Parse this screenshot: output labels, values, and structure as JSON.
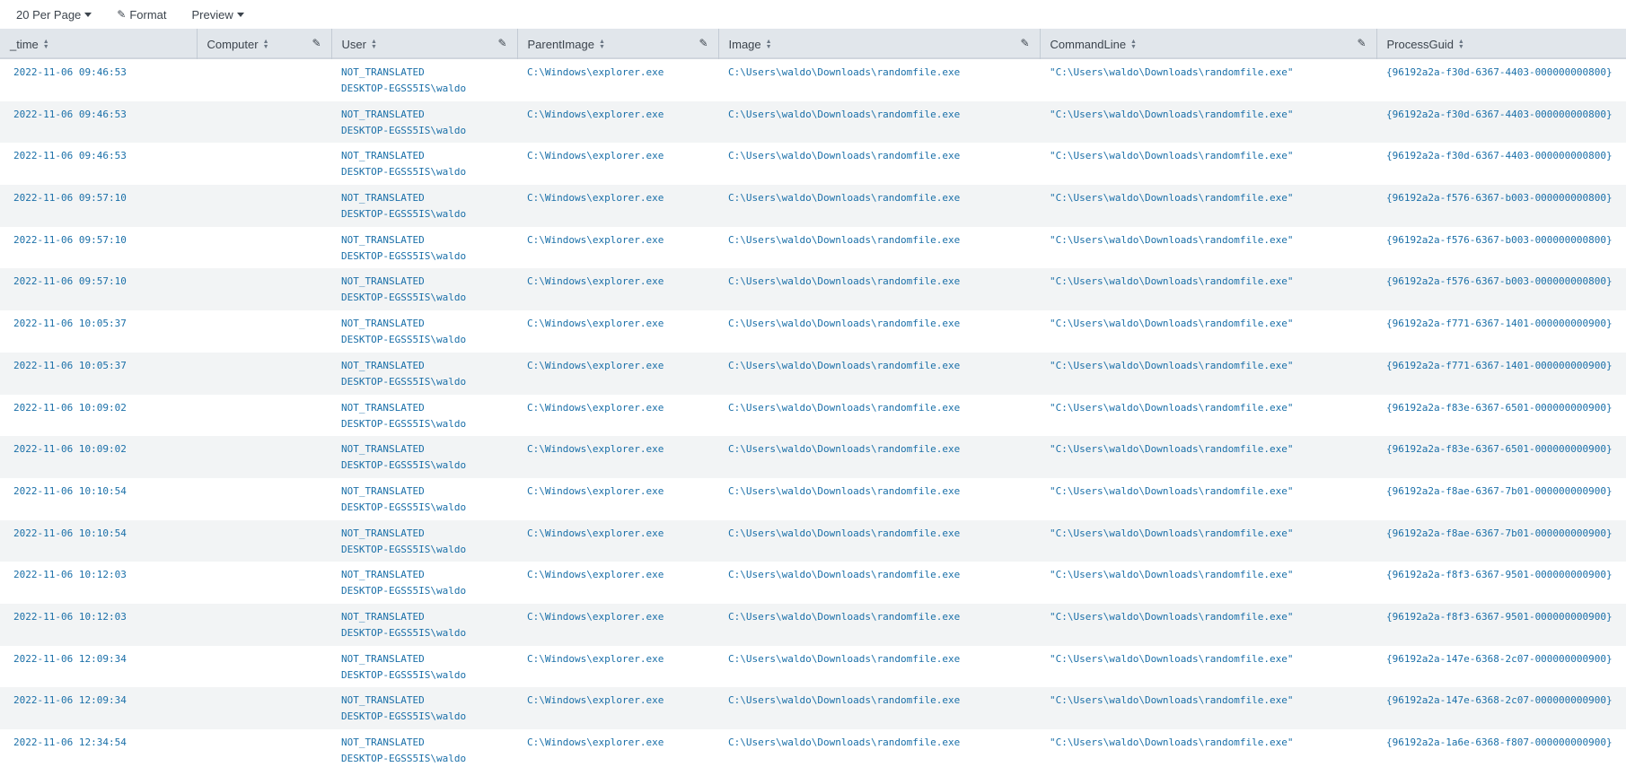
{
  "toolbar": {
    "per_page_label": "20 Per Page",
    "format_label": "Format",
    "preview_label": "Preview"
  },
  "columns": [
    {
      "label": "_time",
      "editable": false
    },
    {
      "label": "Computer",
      "editable": true
    },
    {
      "label": "User",
      "editable": true
    },
    {
      "label": "ParentImage",
      "editable": true
    },
    {
      "label": "Image",
      "editable": true
    },
    {
      "label": "CommandLine",
      "editable": true
    },
    {
      "label": "ProcessGuid",
      "editable": false
    }
  ],
  "rows": [
    {
      "time": "2022-11-06 09:46:53",
      "computer": "",
      "user_1": "NOT_TRANSLATED",
      "user_2": "DESKTOP-EGSS5IS\\waldo",
      "parent_image": "C:\\Windows\\explorer.exe",
      "image": "C:\\Users\\waldo\\Downloads\\randomfile.exe",
      "command_line": "\"C:\\Users\\waldo\\Downloads\\randomfile.exe\"",
      "process_guid": "{96192a2a-f30d-6367-4403-000000000800}"
    },
    {
      "time": "2022-11-06 09:46:53",
      "computer": "",
      "user_1": "NOT_TRANSLATED",
      "user_2": "DESKTOP-EGSS5IS\\waldo",
      "parent_image": "C:\\Windows\\explorer.exe",
      "image": "C:\\Users\\waldo\\Downloads\\randomfile.exe",
      "command_line": "\"C:\\Users\\waldo\\Downloads\\randomfile.exe\"",
      "process_guid": "{96192a2a-f30d-6367-4403-000000000800}"
    },
    {
      "time": "2022-11-06 09:46:53",
      "computer": "",
      "user_1": "NOT_TRANSLATED",
      "user_2": "DESKTOP-EGSS5IS\\waldo",
      "parent_image": "C:\\Windows\\explorer.exe",
      "image": "C:\\Users\\waldo\\Downloads\\randomfile.exe",
      "command_line": "\"C:\\Users\\waldo\\Downloads\\randomfile.exe\"",
      "process_guid": "{96192a2a-f30d-6367-4403-000000000800}"
    },
    {
      "time": "2022-11-06 09:57:10",
      "computer": "",
      "user_1": "NOT_TRANSLATED",
      "user_2": "DESKTOP-EGSS5IS\\waldo",
      "parent_image": "C:\\Windows\\explorer.exe",
      "image": "C:\\Users\\waldo\\Downloads\\randomfile.exe",
      "command_line": "\"C:\\Users\\waldo\\Downloads\\randomfile.exe\"",
      "process_guid": "{96192a2a-f576-6367-b003-000000000800}"
    },
    {
      "time": "2022-11-06 09:57:10",
      "computer": "",
      "user_1": "NOT_TRANSLATED",
      "user_2": "DESKTOP-EGSS5IS\\waldo",
      "parent_image": "C:\\Windows\\explorer.exe",
      "image": "C:\\Users\\waldo\\Downloads\\randomfile.exe",
      "command_line": "\"C:\\Users\\waldo\\Downloads\\randomfile.exe\"",
      "process_guid": "{96192a2a-f576-6367-b003-000000000800}"
    },
    {
      "time": "2022-11-06 09:57:10",
      "computer": "",
      "user_1": "NOT_TRANSLATED",
      "user_2": "DESKTOP-EGSS5IS\\waldo",
      "parent_image": "C:\\Windows\\explorer.exe",
      "image": "C:\\Users\\waldo\\Downloads\\randomfile.exe",
      "command_line": "\"C:\\Users\\waldo\\Downloads\\randomfile.exe\"",
      "process_guid": "{96192a2a-f576-6367-b003-000000000800}"
    },
    {
      "time": "2022-11-06 10:05:37",
      "computer": "",
      "user_1": "NOT_TRANSLATED",
      "user_2": "DESKTOP-EGSS5IS\\waldo",
      "parent_image": "C:\\Windows\\explorer.exe",
      "image": "C:\\Users\\waldo\\Downloads\\randomfile.exe",
      "command_line": "\"C:\\Users\\waldo\\Downloads\\randomfile.exe\"",
      "process_guid": "{96192a2a-f771-6367-1401-000000000900}"
    },
    {
      "time": "2022-11-06 10:05:37",
      "computer": "",
      "user_1": "NOT_TRANSLATED",
      "user_2": "DESKTOP-EGSS5IS\\waldo",
      "parent_image": "C:\\Windows\\explorer.exe",
      "image": "C:\\Users\\waldo\\Downloads\\randomfile.exe",
      "command_line": "\"C:\\Users\\waldo\\Downloads\\randomfile.exe\"",
      "process_guid": "{96192a2a-f771-6367-1401-000000000900}"
    },
    {
      "time": "2022-11-06 10:09:02",
      "computer": "",
      "user_1": "NOT_TRANSLATED",
      "user_2": "DESKTOP-EGSS5IS\\waldo",
      "parent_image": "C:\\Windows\\explorer.exe",
      "image": "C:\\Users\\waldo\\Downloads\\randomfile.exe",
      "command_line": "\"C:\\Users\\waldo\\Downloads\\randomfile.exe\"",
      "process_guid": "{96192a2a-f83e-6367-6501-000000000900}"
    },
    {
      "time": "2022-11-06 10:09:02",
      "computer": "",
      "user_1": "NOT_TRANSLATED",
      "user_2": "DESKTOP-EGSS5IS\\waldo",
      "parent_image": "C:\\Windows\\explorer.exe",
      "image": "C:\\Users\\waldo\\Downloads\\randomfile.exe",
      "command_line": "\"C:\\Users\\waldo\\Downloads\\randomfile.exe\"",
      "process_guid": "{96192a2a-f83e-6367-6501-000000000900}"
    },
    {
      "time": "2022-11-06 10:10:54",
      "computer": "",
      "user_1": "NOT_TRANSLATED",
      "user_2": "DESKTOP-EGSS5IS\\waldo",
      "parent_image": "C:\\Windows\\explorer.exe",
      "image": "C:\\Users\\waldo\\Downloads\\randomfile.exe",
      "command_line": "\"C:\\Users\\waldo\\Downloads\\randomfile.exe\"",
      "process_guid": "{96192a2a-f8ae-6367-7b01-000000000900}"
    },
    {
      "time": "2022-11-06 10:10:54",
      "computer": "",
      "user_1": "NOT_TRANSLATED",
      "user_2": "DESKTOP-EGSS5IS\\waldo",
      "parent_image": "C:\\Windows\\explorer.exe",
      "image": "C:\\Users\\waldo\\Downloads\\randomfile.exe",
      "command_line": "\"C:\\Users\\waldo\\Downloads\\randomfile.exe\"",
      "process_guid": "{96192a2a-f8ae-6367-7b01-000000000900}"
    },
    {
      "time": "2022-11-06 10:12:03",
      "computer": "",
      "user_1": "NOT_TRANSLATED",
      "user_2": "DESKTOP-EGSS5IS\\waldo",
      "parent_image": "C:\\Windows\\explorer.exe",
      "image": "C:\\Users\\waldo\\Downloads\\randomfile.exe",
      "command_line": "\"C:\\Users\\waldo\\Downloads\\randomfile.exe\"",
      "process_guid": "{96192a2a-f8f3-6367-9501-000000000900}"
    },
    {
      "time": "2022-11-06 10:12:03",
      "computer": "",
      "user_1": "NOT_TRANSLATED",
      "user_2": "DESKTOP-EGSS5IS\\waldo",
      "parent_image": "C:\\Windows\\explorer.exe",
      "image": "C:\\Users\\waldo\\Downloads\\randomfile.exe",
      "command_line": "\"C:\\Users\\waldo\\Downloads\\randomfile.exe\"",
      "process_guid": "{96192a2a-f8f3-6367-9501-000000000900}"
    },
    {
      "time": "2022-11-06 12:09:34",
      "computer": "",
      "user_1": "NOT_TRANSLATED",
      "user_2": "DESKTOP-EGSS5IS\\waldo",
      "parent_image": "C:\\Windows\\explorer.exe",
      "image": "C:\\Users\\waldo\\Downloads\\randomfile.exe",
      "command_line": "\"C:\\Users\\waldo\\Downloads\\randomfile.exe\"",
      "process_guid": "{96192a2a-147e-6368-2c07-000000000900}"
    },
    {
      "time": "2022-11-06 12:09:34",
      "computer": "",
      "user_1": "NOT_TRANSLATED",
      "user_2": "DESKTOP-EGSS5IS\\waldo",
      "parent_image": "C:\\Windows\\explorer.exe",
      "image": "C:\\Users\\waldo\\Downloads\\randomfile.exe",
      "command_line": "\"C:\\Users\\waldo\\Downloads\\randomfile.exe\"",
      "process_guid": "{96192a2a-147e-6368-2c07-000000000900}"
    },
    {
      "time": "2022-11-06 12:34:54",
      "computer": "",
      "user_1": "NOT_TRANSLATED",
      "user_2": "DESKTOP-EGSS5IS\\waldo",
      "parent_image": "C:\\Windows\\explorer.exe",
      "image": "C:\\Users\\waldo\\Downloads\\randomfile.exe",
      "command_line": "\"C:\\Users\\waldo\\Downloads\\randomfile.exe\"",
      "process_guid": "{96192a2a-1a6e-6368-f807-000000000900}"
    }
  ],
  "colors": {
    "link": "#1a6fa8",
    "header_bg": "#e1e6eb",
    "stripe_bg": "#f2f4f5",
    "text": "#3c444d"
  }
}
